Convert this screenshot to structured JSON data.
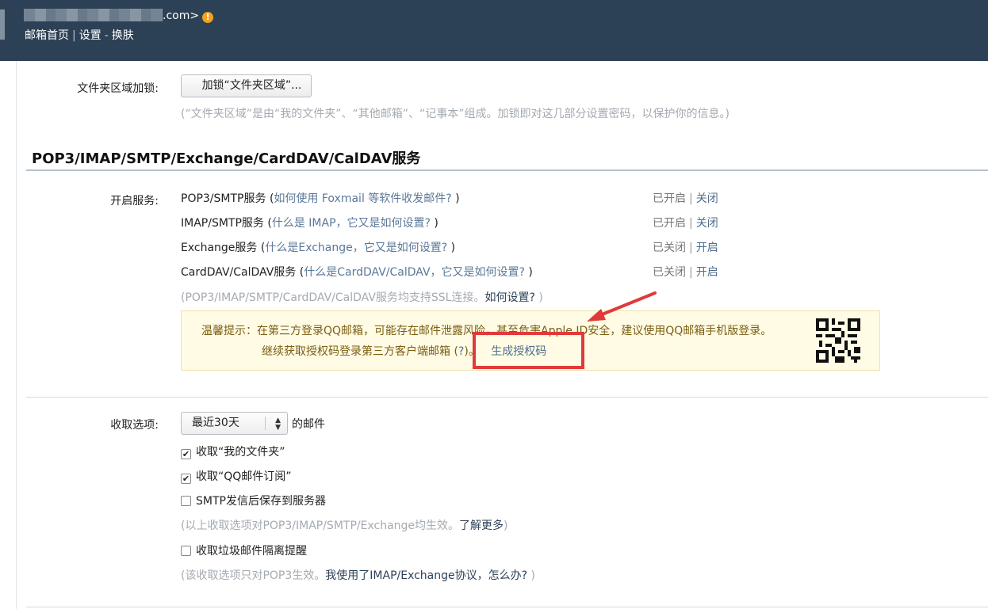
{
  "header": {
    "email_suffix": ".com>",
    "warn_icon": "!",
    "nav": {
      "home": "邮箱首页",
      "sep": "|",
      "settings": "设置",
      "dash": "-",
      "skin": "换肤"
    }
  },
  "folder_lock": {
    "label": "文件夹区域加锁:",
    "button": "加锁“文件夹区域”...",
    "hint": "(“文件夹区域”是由“我的文件夹”、“其他邮箱”、“记事本”组成。加锁即对这几部分设置密码，以保护你的信息。)"
  },
  "services": {
    "title": "POP3/IMAP/SMTP/Exchange/CardDAV/CalDAV服务",
    "label": "开启服务:",
    "rows": [
      {
        "name": "POP3/SMTP服务",
        "open": " (",
        "q": "如何使用 Foxmail 等软件收发邮件?",
        "close": " )",
        "status": "已开启",
        "bar": "|",
        "toggle": "关闭"
      },
      {
        "name": "IMAP/SMTP服务",
        "open": " (",
        "q": "什么是 IMAP，它又是如何设置?",
        "close": " )",
        "status": "已开启",
        "bar": "|",
        "toggle": "关闭"
      },
      {
        "name": "Exchange服务",
        "open": " (",
        "q": "什么是Exchange，它又是如何设置?",
        "close": " )",
        "status": "已关闭",
        "bar": "|",
        "toggle": "开启"
      },
      {
        "name": "CardDAV/CalDAV服务",
        "open": " (",
        "q": "什么是CardDAV/CalDAV，它又是如何设置?",
        "close": " )",
        "status": "已关闭",
        "bar": "|",
        "toggle": "开启"
      }
    ],
    "ssl_hint": "(POP3/IMAP/SMTP/CardDAV/CalDAV服务均支持SSL连接。",
    "ssl_link": "如何设置?",
    "ssl_close": " )",
    "tip": {
      "line1": "温馨提示：在第三方登录QQ邮箱，可能存在邮件泄露风险，甚至危害Apple ID安全，建议使用QQ邮箱手机版登录。",
      "line2": "继续获取授权码登录第三方客户端邮箱 (",
      "line2_q": "?",
      "line2_end": ")。",
      "gen_link": "生成授权码"
    }
  },
  "receive": {
    "label": "收取选项:",
    "select_value": "最近30天",
    "select_suffix": "的邮件",
    "options": [
      {
        "label": "收取“我的文件夹”",
        "checked": true
      },
      {
        "label": "收取“QQ邮件订阅”",
        "checked": true
      },
      {
        "label": "SMTP发信后保存到服务器",
        "checked": false
      }
    ],
    "hint1": "(以上收取选项对POP3/IMAP/SMTP/Exchange均生效。",
    "hint1_link": "了解更多",
    "hint1_end": ")",
    "junk": {
      "label": "收取垃圾邮件隔离提醒",
      "checked": false
    },
    "hint2": "(该收取选项只对POP3生效。",
    "hint2_link": "我使用了IMAP/Exchange协议，怎么办?",
    "hint2_end": " )"
  },
  "colors": {
    "header_bg": "#2d4156",
    "link": "#4f6e8e",
    "annotation": "#e03a3a",
    "tip_bg": "#fffbe5"
  }
}
